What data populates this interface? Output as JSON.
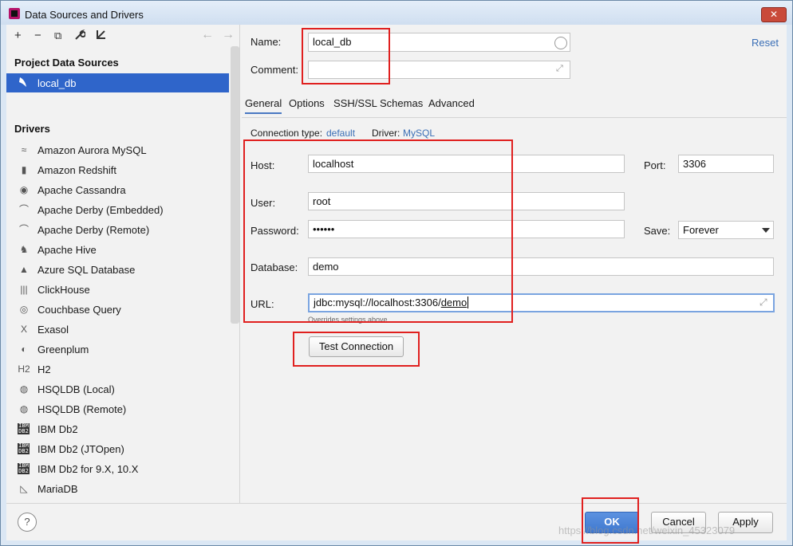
{
  "window": {
    "title": "Data Sources and Drivers",
    "close_label": "✕"
  },
  "toolbar": {
    "add_icon": "+",
    "remove_icon": "−",
    "copy_icon": "⧉",
    "wrench_icon": "🔧",
    "import_icon": "⇲",
    "back_icon": "←",
    "forward_icon": "→"
  },
  "left": {
    "project_header": "Project Data Sources",
    "selected_source": "local_db",
    "drivers_header": "Drivers",
    "drivers": [
      {
        "label": "Amazon Aurora MySQL",
        "icon": "≈"
      },
      {
        "label": "Amazon Redshift",
        "icon": "▮"
      },
      {
        "label": "Apache Cassandra",
        "icon": "◉"
      },
      {
        "label": "Apache Derby (Embedded)",
        "icon": "⌒"
      },
      {
        "label": "Apache Derby (Remote)",
        "icon": "⌒"
      },
      {
        "label": "Apache Hive",
        "icon": "♞"
      },
      {
        "label": "Azure SQL Database",
        "icon": "▲"
      },
      {
        "label": "ClickHouse",
        "icon": "|||"
      },
      {
        "label": "Couchbase Query",
        "icon": "◎"
      },
      {
        "label": "Exasol",
        "icon": "X"
      },
      {
        "label": "Greenplum",
        "icon": "◐"
      },
      {
        "label": "H2",
        "icon": "H2"
      },
      {
        "label": "HSQLDB (Local)",
        "icon": "◍"
      },
      {
        "label": "HSQLDB (Remote)",
        "icon": "◍"
      },
      {
        "label": "IBM Db2",
        "icon": "IBM DB2"
      },
      {
        "label": "IBM Db2 (JTOpen)",
        "icon": "IBM DB2"
      },
      {
        "label": "IBM Db2 for 9.X, 10.X",
        "icon": "IBM DB2"
      },
      {
        "label": "MariaDB",
        "icon": "◺"
      }
    ]
  },
  "form": {
    "name_label": "Name:",
    "name_value": "local_db",
    "comment_label": "Comment:",
    "comment_value": "",
    "reset_label": "Reset",
    "tabs": [
      "General",
      "Options",
      "SSH/SSL",
      "Schemas",
      "Advanced"
    ],
    "connection_type_label": "Connection type:",
    "connection_type_value": "default",
    "driver_label": "Driver:",
    "driver_value": "MySQL",
    "host_label": "Host:",
    "host_value": "localhost",
    "port_label": "Port:",
    "port_value": "3306",
    "user_label": "User:",
    "user_value": "root",
    "password_label": "Password:",
    "password_value": "••••••",
    "save_label": "Save:",
    "save_value": "Forever",
    "database_label": "Database:",
    "database_value": "demo",
    "url_label": "URL:",
    "url_prefix": "jdbc:mysql://localhost:3306/",
    "url_db": "demo",
    "url_hint": "Overrides settings above",
    "test_connection_label": "Test Connection"
  },
  "footer": {
    "help_label": "?",
    "ok_label": "OK",
    "cancel_label": "Cancel",
    "apply_label": "Apply",
    "watermark": "https://blog.csdn.net/weixin_45323079"
  },
  "colors": {
    "selection": "#2f65ca",
    "link": "#3b6fb6",
    "annotation": "#e0201f"
  }
}
